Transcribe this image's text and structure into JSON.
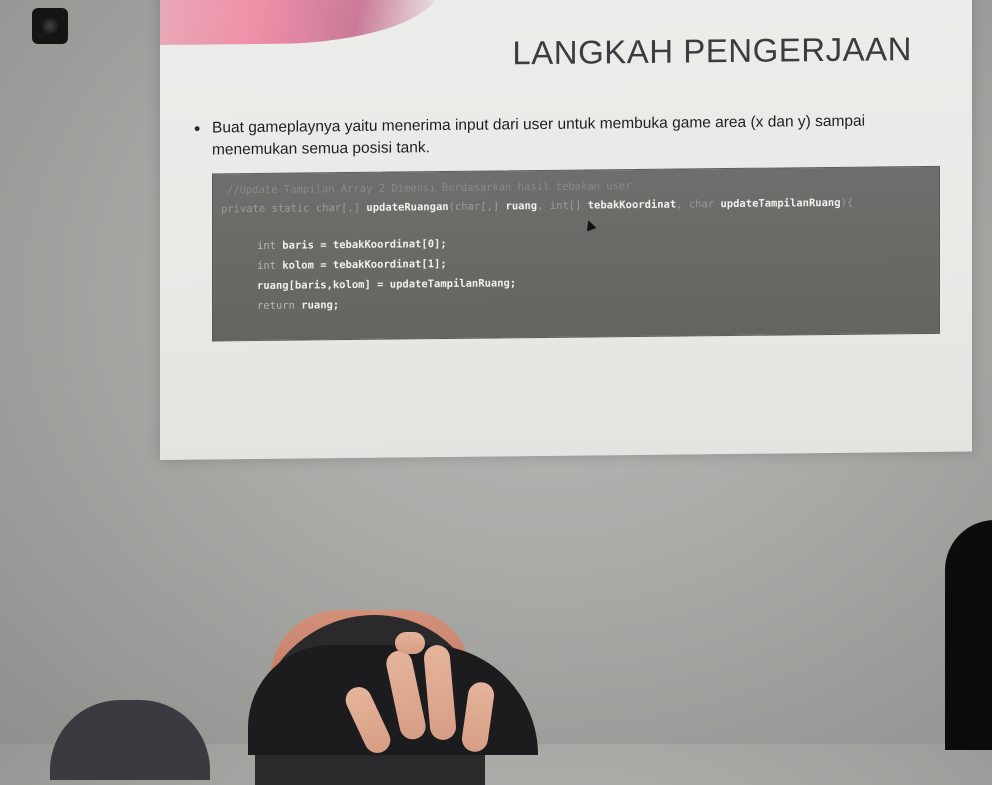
{
  "slide": {
    "title": "LANGKAH PENGERJAAN",
    "bullet_text": "Buat gameplaynya yaitu menerima input dari user untuk membuka game area (x dan y) sampai menemukan semua posisi tank."
  },
  "code": {
    "comment": "//Update Tampilan Array 2 Dimensi Berdasarkan hasil tebakan user",
    "signature_prefix": "private static char[,] ",
    "method_name": "updateRuangan",
    "signature_rest_1": "(char[,] ",
    "param_ruang": "ruang",
    "signature_rest_2": ", int[] ",
    "param_tebak": "tebakKoordinat",
    "signature_rest_3": ", char ",
    "param_update": "updateTampilanRuang",
    "signature_end": "){",
    "line1_kw": "int ",
    "line1_body": "baris = tebakKoordinat[0];",
    "line2_kw": "int ",
    "line2_body": "kolom = tebakKoordinat[1];",
    "line3": "ruang[baris,kolom] = updateTampilanRuang;",
    "line4_kw": "return ",
    "line4_body": "ruang;"
  },
  "colors": {
    "slide_bg": "#ebebe8",
    "code_bg": "#6a6b67",
    "accent": "#f08fa8",
    "title_text": "#3c3c40"
  },
  "icons": [
    "mouse-cursor-icon",
    "projector-icon"
  ]
}
